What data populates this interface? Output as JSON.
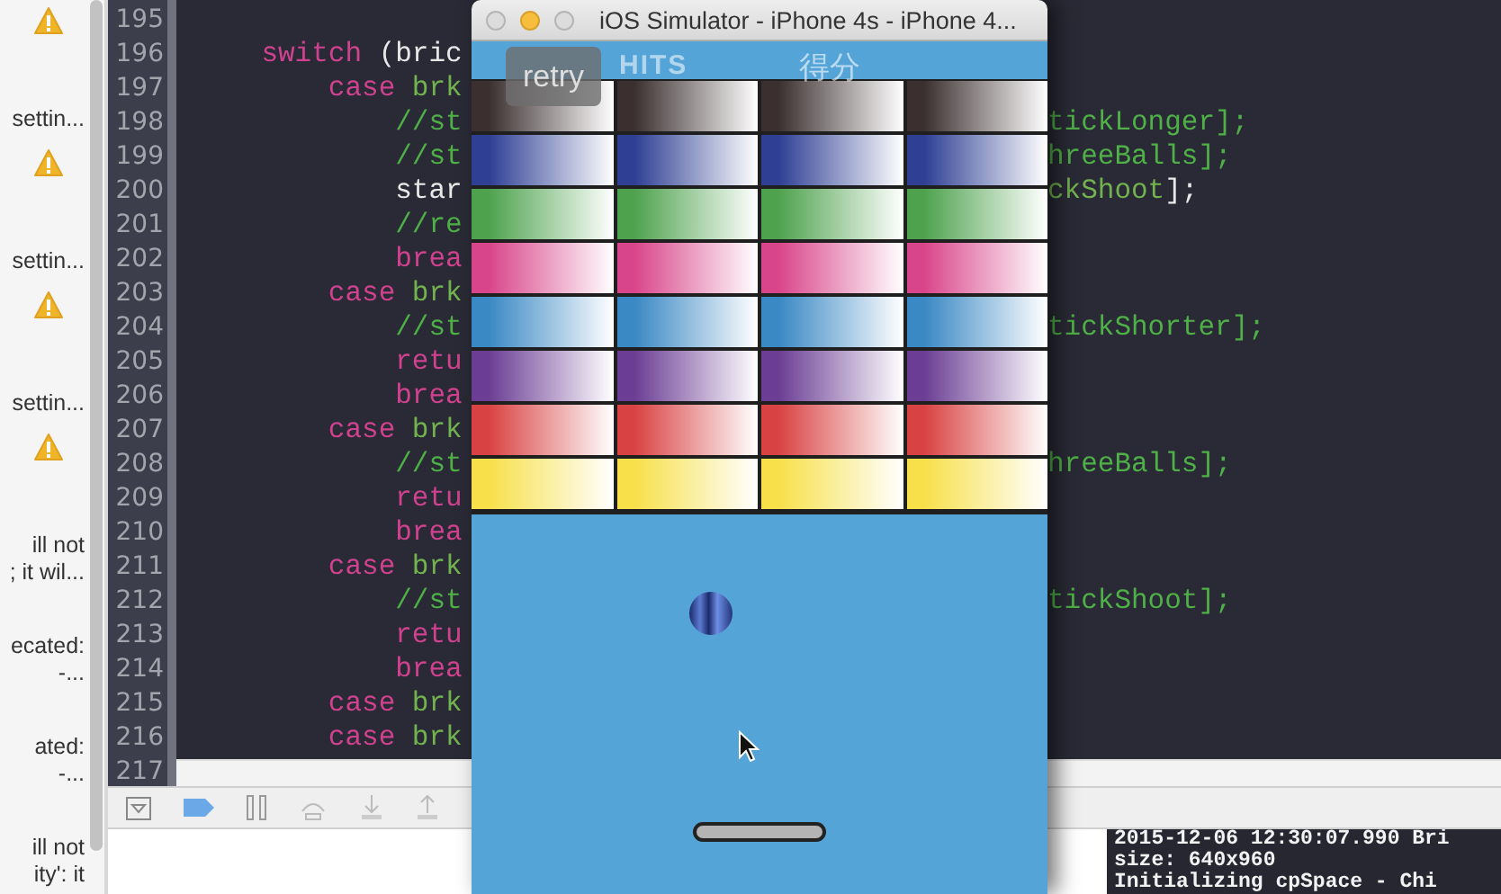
{
  "issue_navigator": {
    "items": [
      {
        "kind": "warning"
      },
      {
        "kind": "text",
        "lines": [
          "settin..."
        ]
      },
      {
        "kind": "warning"
      },
      {
        "kind": "text",
        "lines": [
          "settin..."
        ]
      },
      {
        "kind": "warning"
      },
      {
        "kind": "text",
        "lines": [
          "settin..."
        ]
      },
      {
        "kind": "warning"
      },
      {
        "kind": "text",
        "lines": [
          "ill not",
          "; it wil..."
        ]
      },
      {
        "kind": "text",
        "lines": [
          "ecated:",
          "-..."
        ]
      },
      {
        "kind": "text",
        "lines": [
          "ated:",
          "-..."
        ]
      },
      {
        "kind": "text",
        "lines": [
          "ill not",
          "ity': it"
        ]
      }
    ]
  },
  "editor": {
    "lines": [
      {
        "number": "195"
      },
      {
        "number": "196",
        "left": [
          {
            "kind": "keyword",
            "text": "    switch"
          },
          {
            "kind": "plain",
            "text": " (bric"
          }
        ]
      },
      {
        "number": "197",
        "left": [
          {
            "kind": "keyword",
            "text": "        case"
          },
          {
            "kind": "ident",
            "text": " brk"
          }
        ]
      },
      {
        "number": "198",
        "left": [
          {
            "kind": "comment",
            "text": "            //st"
          }
        ],
        "right": [
          {
            "kind": "comment",
            "text": "tickLonger];"
          }
        ]
      },
      {
        "number": "199",
        "left": [
          {
            "kind": "comment",
            "text": "            //st"
          }
        ],
        "right": [
          {
            "kind": "comment",
            "text": "hreeBalls];"
          }
        ]
      },
      {
        "number": "200",
        "left": [
          {
            "kind": "plain",
            "text": "            star"
          }
        ],
        "right": [
          {
            "kind": "ident",
            "text": "ckShoot"
          },
          {
            "kind": "plain",
            "text": "];"
          }
        ]
      },
      {
        "number": "201",
        "left": [
          {
            "kind": "comment",
            "text": "            //re"
          }
        ]
      },
      {
        "number": "202",
        "left": [
          {
            "kind": "keyword",
            "text": "            brea"
          }
        ]
      },
      {
        "number": "203",
        "left": [
          {
            "kind": "keyword",
            "text": "        case"
          },
          {
            "kind": "ident",
            "text": " brk"
          }
        ]
      },
      {
        "number": "204",
        "left": [
          {
            "kind": "comment",
            "text": "            //st"
          }
        ],
        "right": [
          {
            "kind": "comment",
            "text": "tickShorter];"
          }
        ]
      },
      {
        "number": "205",
        "left": [
          {
            "kind": "keyword",
            "text": "            retu"
          }
        ]
      },
      {
        "number": "206",
        "left": [
          {
            "kind": "keyword",
            "text": "            brea"
          }
        ]
      },
      {
        "number": "207",
        "left": [
          {
            "kind": "keyword",
            "text": "        case"
          },
          {
            "kind": "ident",
            "text": " brk"
          }
        ]
      },
      {
        "number": "208",
        "left": [
          {
            "kind": "comment",
            "text": "            //st"
          }
        ],
        "right": [
          {
            "kind": "comment",
            "text": "hreeBalls];"
          }
        ]
      },
      {
        "number": "209",
        "left": [
          {
            "kind": "keyword",
            "text": "            retu"
          }
        ]
      },
      {
        "number": "210",
        "left": [
          {
            "kind": "keyword",
            "text": "            brea"
          }
        ]
      },
      {
        "number": "211",
        "left": [
          {
            "kind": "keyword",
            "text": "        case"
          },
          {
            "kind": "ident",
            "text": " brk"
          }
        ]
      },
      {
        "number": "212",
        "left": [
          {
            "kind": "comment",
            "text": "            //st"
          }
        ],
        "right": [
          {
            "kind": "comment",
            "text": "tickShoot];"
          }
        ]
      },
      {
        "number": "213",
        "left": [
          {
            "kind": "keyword",
            "text": "            retu"
          }
        ]
      },
      {
        "number": "214",
        "left": [
          {
            "kind": "keyword",
            "text": "            brea"
          }
        ]
      },
      {
        "number": "215",
        "left": [
          {
            "kind": "keyword",
            "text": "        case"
          },
          {
            "kind": "ident",
            "text": " brk"
          }
        ]
      },
      {
        "number": "216",
        "left": [
          {
            "kind": "keyword",
            "text": "        case"
          },
          {
            "kind": "ident",
            "text": " brk"
          }
        ]
      },
      {
        "number": "217"
      }
    ]
  },
  "simulator": {
    "title": "iOS Simulator - iPhone 4s - iPhone 4...",
    "retry": "retry",
    "hits": "HITS",
    "score": "得分",
    "brick_rows": [
      {
        "bricks": [
          {
            "color": "#3b2f2f"
          },
          {
            "color": "#3b2f2f"
          },
          {
            "color": "#3b2f2f"
          },
          {
            "color": "#3b2f2f"
          }
        ]
      },
      {
        "bricks": [
          {
            "color": "#2e3f94"
          },
          {
            "color": "#2e3f94"
          },
          {
            "color": "#2e3f94"
          },
          {
            "color": "#2e3f94"
          }
        ]
      },
      {
        "bricks": [
          {
            "color": "#4ea24e"
          },
          {
            "color": "#4ea24e"
          },
          {
            "color": "#4ea24e"
          },
          {
            "color": "#4ea24e"
          }
        ]
      },
      {
        "bricks": [
          {
            "color": "#d9458a"
          },
          {
            "color": "#d9458a"
          },
          {
            "color": "#d9458a"
          },
          {
            "color": "#d9458a"
          }
        ]
      },
      {
        "bricks": [
          {
            "color": "#3a88c4"
          },
          {
            "color": "#3a88c4"
          },
          {
            "color": "#3a88c4"
          },
          {
            "color": "#3a88c4"
          }
        ]
      },
      {
        "bricks": [
          {
            "color": "#6b3d94"
          },
          {
            "color": "#6b3d94"
          },
          {
            "color": "#6b3d94"
          },
          {
            "color": "#6b3d94"
          }
        ]
      },
      {
        "bricks": [
          {
            "color": "#d94242"
          },
          {
            "color": "#d94242"
          },
          {
            "color": "#d94242"
          },
          {
            "color": "#d94242"
          }
        ]
      },
      {
        "bricks": [
          {
            "color": "#f7e04a"
          },
          {
            "color": "#f7e04a"
          },
          {
            "color": "#f7e04a"
          },
          {
            "color": "#f7e04a"
          }
        ]
      }
    ]
  },
  "console": {
    "lines": [
      "2015-12-06 12:30:07.990 Bri",
      "size: 640x960",
      "Initializing cpSpace - Chi"
    ]
  }
}
